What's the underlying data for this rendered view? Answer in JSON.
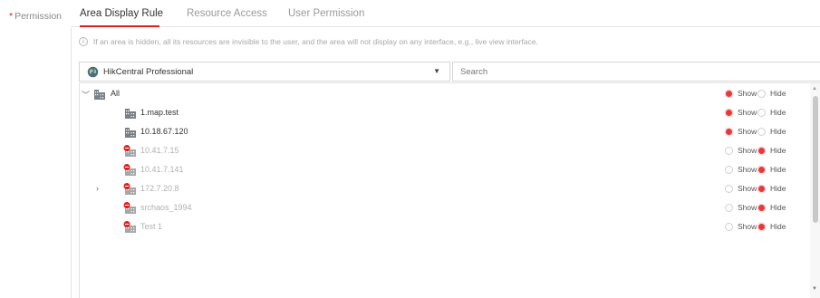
{
  "permission": {
    "required_mark": "*",
    "label": "Permission"
  },
  "tabs": [
    {
      "label": "Area Display Rule",
      "active": true
    },
    {
      "label": "Resource Access",
      "active": false
    },
    {
      "label": "User Permission",
      "active": false
    }
  ],
  "hint": {
    "icon": "info-icon",
    "text": "If an area is hidden, all its resources are invisible to the user, and the area will not display on any interface, e.g., live view interface."
  },
  "site_select": {
    "icon": "globe-icon",
    "value": "HikCentral Professional",
    "caret": "▼"
  },
  "search": {
    "placeholder": "Search"
  },
  "option_labels": {
    "show": "Show",
    "hide": "Hide"
  },
  "colors": {
    "accent": "#e02020",
    "radio_on": "#e8383d"
  },
  "tree": [
    {
      "label": "All",
      "icon": "building-icon",
      "expander": "﹀",
      "state": "show",
      "dim": false
    },
    {
      "label": "1.map.test",
      "icon": "building-icon",
      "expander": "",
      "state": "show",
      "dim": false
    },
    {
      "label": "10.18.67.120",
      "icon": "building-icon",
      "expander": "",
      "state": "show",
      "dim": false
    },
    {
      "label": "10.41.7.15",
      "icon": "building-hidden-icon",
      "expander": "",
      "state": "hide",
      "dim": true
    },
    {
      "label": "10.41.7.141",
      "icon": "building-hidden-icon",
      "expander": "",
      "state": "hide",
      "dim": true
    },
    {
      "label": "172.7.20.8",
      "icon": "building-hidden-icon",
      "expander": "›",
      "state": "hide",
      "dim": true
    },
    {
      "label": "srchaos_1994",
      "icon": "building-hidden-icon",
      "expander": "",
      "state": "hide",
      "dim": true
    },
    {
      "label": "Test 1",
      "icon": "building-hidden-icon",
      "expander": "",
      "state": "hide",
      "dim": true
    }
  ]
}
